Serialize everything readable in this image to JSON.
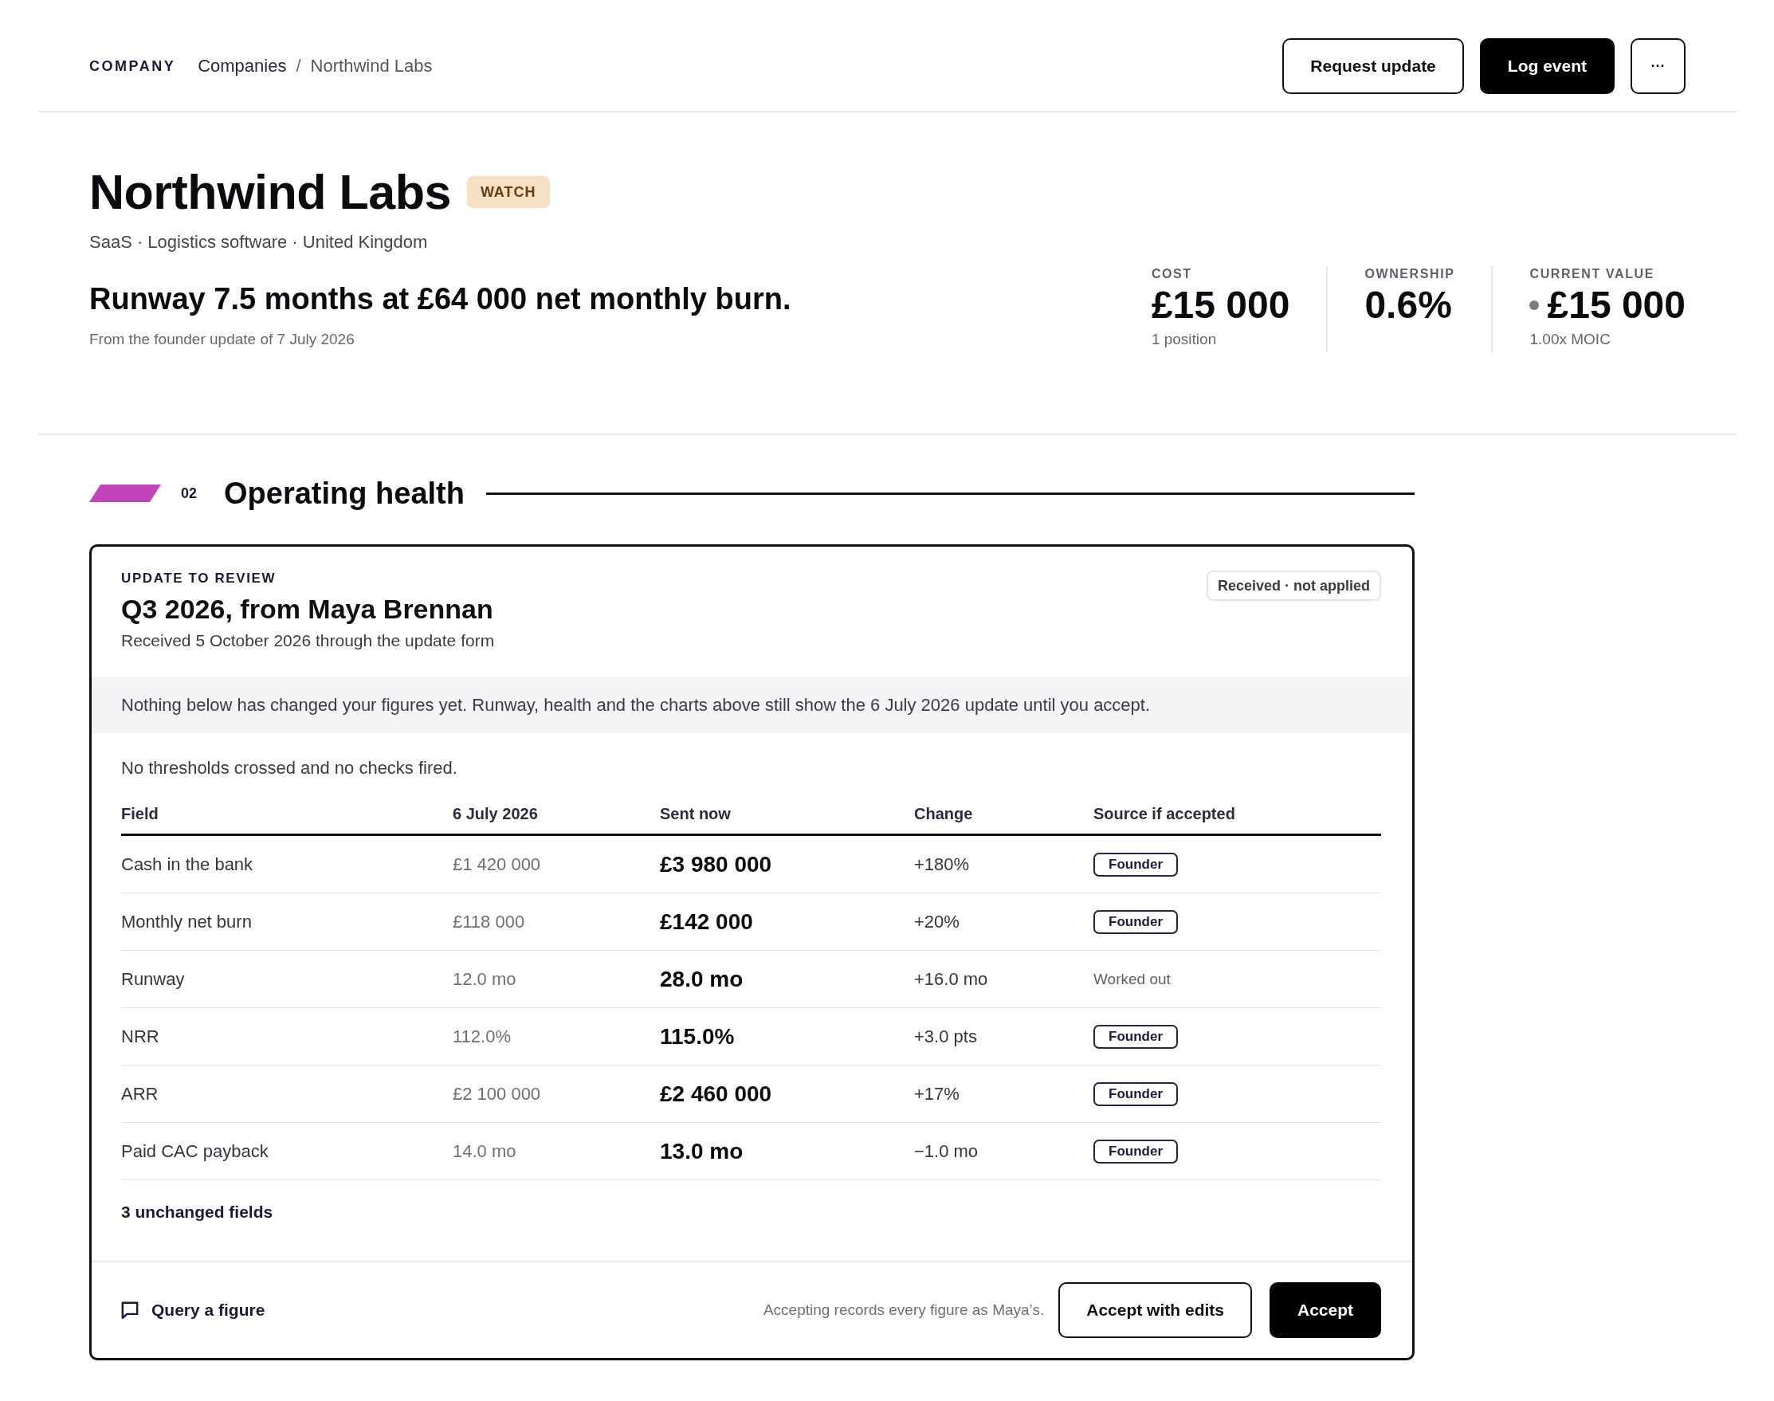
{
  "topbar": {
    "section_label": "COMPANY",
    "breadcrumb": [
      {
        "label": "Companies",
        "current": false
      },
      {
        "label": "Northwind Labs",
        "current": true
      }
    ],
    "separator": "/",
    "actions": [
      {
        "label": "Request update",
        "kind": "secondary"
      },
      {
        "label": "Log event",
        "kind": "primary"
      },
      {
        "label": "···",
        "kind": "more"
      }
    ]
  },
  "company": {
    "name": "Northwind Labs",
    "status": "WATCH",
    "meta": "SaaS · Logistics software · United Kingdom",
    "headline": "Runway 7.5 months at £64 000 net monthly burn.",
    "headline_source": "From the founder update of 7 July 2026"
  },
  "stats": [
    {
      "label": "COST",
      "value": "£15 000",
      "note": "1 position",
      "status_dot": false
    },
    {
      "label": "OWNERSHIP",
      "value": "0.6%",
      "status_dot": false
    },
    {
      "label": "CURRENT VALUE",
      "value": "£15 000",
      "note": "1.00x MOIC",
      "status_dot": true
    }
  ],
  "section": {
    "number": "02",
    "title": "Operating health"
  },
  "review": {
    "eyebrow": "UPDATE TO REVIEW",
    "title": "Q3 2026, from Maya Brennan",
    "received": "Received 5 October 2026 through the update form",
    "status": "Received · not applied",
    "notice": "Nothing below has changed your figures yet. Runway, health and the charts above still show the 6 July 2026 update until you accept.",
    "checks": "No thresholds crossed and no checks fired.",
    "table": {
      "columns": [
        "Field",
        "6 July 2026",
        "Sent now",
        "Change",
        "Source if accepted"
      ],
      "rows": [
        {
          "kind": "tag",
          "field": "Cash in the bank",
          "previous": "£1 420 000",
          "sent": "£3 980 000",
          "change": "+180%",
          "source": "Founder"
        },
        {
          "kind": "tag",
          "field": "Monthly net burn",
          "previous": "£118 000",
          "sent": "£142 000",
          "change": "+20%",
          "source": "Founder"
        },
        {
          "kind": "text",
          "field": "Runway",
          "previous": "12.0 mo",
          "sent": "28.0 mo",
          "change": "+16.0 mo",
          "source": "Worked out"
        },
        {
          "kind": "tag",
          "field": "NRR",
          "previous": "112.0%",
          "sent": "115.0%",
          "change": "+3.0 pts",
          "source": "Founder"
        },
        {
          "kind": "tag",
          "field": "ARR",
          "previous": "£2 100 000",
          "sent": "£2 460 000",
          "change": "+17%",
          "source": "Founder"
        },
        {
          "kind": "tag",
          "field": "Paid CAC payback",
          "previous": "14.0 mo",
          "sent": "13.0 mo",
          "change": "−1.0 mo",
          "source": "Founder"
        }
      ]
    },
    "unchanged": "3 unchanged fields",
    "query": "Query a figure",
    "footnote": "Accepting records every figure as Maya’s.",
    "buttons": [
      {
        "label": "Accept with edits",
        "kind": "secondary"
      },
      {
        "label": "Accept",
        "kind": "primary"
      }
    ]
  }
}
